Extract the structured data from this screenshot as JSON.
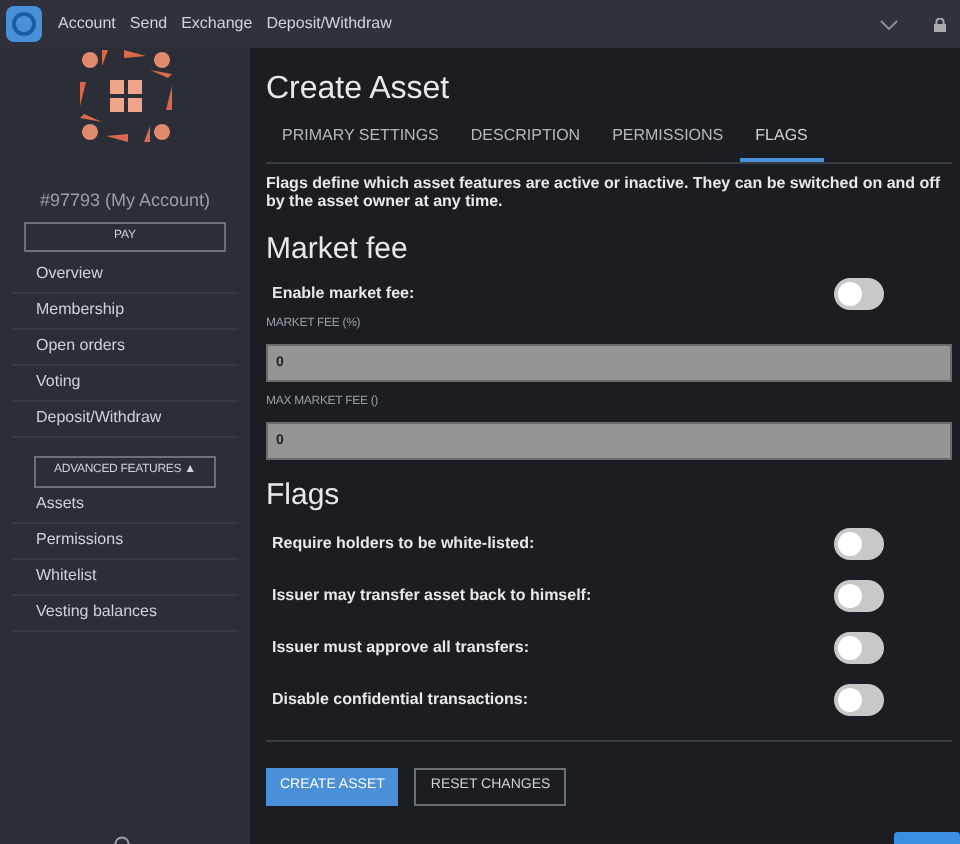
{
  "top_nav": {
    "items": [
      "Account",
      "Send",
      "Exchange",
      "Deposit/Withdraw"
    ]
  },
  "sidebar": {
    "account": "#97793 (My Account)",
    "pay_button": "PAY",
    "items": [
      {
        "label": "Overview"
      },
      {
        "label": "Membership"
      },
      {
        "label": "Open orders"
      },
      {
        "label": "Voting"
      },
      {
        "label": "Deposit/Withdraw"
      }
    ],
    "advanced_button": "ADVANCED FEATURES ▲",
    "advanced_items": [
      {
        "label": "Assets"
      },
      {
        "label": "Permissions"
      },
      {
        "label": "Whitelist"
      },
      {
        "label": "Vesting balances"
      }
    ]
  },
  "main": {
    "title": "Create Asset",
    "tabs": [
      {
        "label": "PRIMARY SETTINGS",
        "selected": false
      },
      {
        "label": "DESCRIPTION",
        "selected": false
      },
      {
        "label": "PERMISSIONS",
        "selected": false
      },
      {
        "label": "FLAGS",
        "selected": true
      }
    ],
    "description": "Flags define which asset features are active or inactive. They can be switched on and off by the asset owner at any time.",
    "market_fee": {
      "heading": "Market fee",
      "toggle": {
        "label": "Enable market fee:",
        "on": false
      },
      "fields": [
        {
          "label": "MARKET FEE (%)",
          "value": "0"
        },
        {
          "label": "MAX MARKET FEE ()",
          "value": "0"
        }
      ]
    },
    "flags": {
      "heading": "Flags",
      "items": [
        {
          "label": "Require holders to be white-listed:",
          "on": false
        },
        {
          "label": "Issuer may transfer asset back to himself:",
          "on": false
        },
        {
          "label": "Issuer must approve all transfers:",
          "on": false
        },
        {
          "label": "Disable confidential transactions:",
          "on": false
        }
      ]
    },
    "buttons": [
      {
        "label": "CREATE ASSET",
        "kind": "primary"
      },
      {
        "label": "RESET CHANGES",
        "kind": "outline"
      }
    ]
  }
}
